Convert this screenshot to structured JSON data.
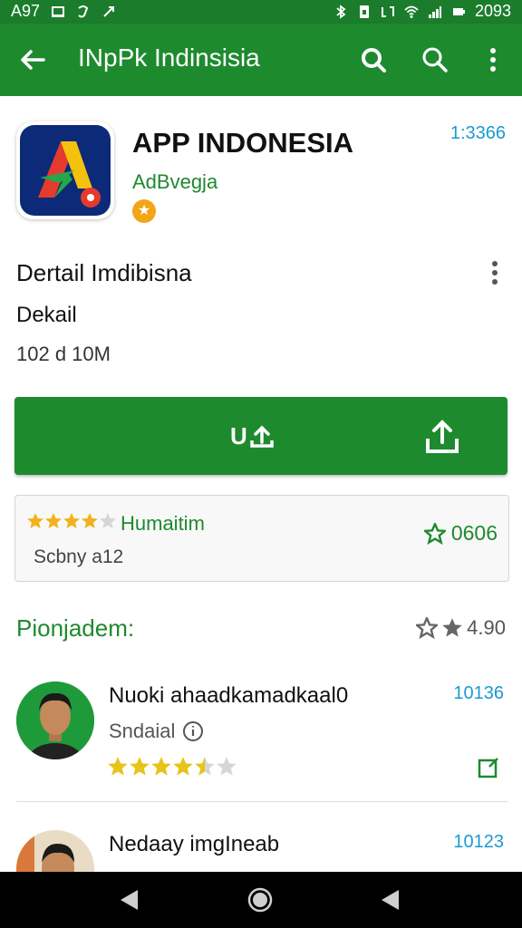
{
  "status_bar": {
    "left_text": "A97",
    "right_text": "2093"
  },
  "app_bar": {
    "title": "INpPk Indinsisia",
    "back_icon": "arrow-back-icon",
    "actions": [
      "search-icon",
      "search-icon",
      "more-vert-icon"
    ]
  },
  "app": {
    "name": "APP INDONESIA",
    "developer": "AdBvegja",
    "badge": "★",
    "time": "1:3366"
  },
  "detail": {
    "title": "Dertail Imdibisna",
    "subtitle": "Dekail",
    "size": "102 d 10M"
  },
  "install": {
    "label": "U"
  },
  "rating_card": {
    "label": "Humaitim",
    "sub": "Scbny a12",
    "value": "0606",
    "stars_full": 4,
    "stars_total": 5
  },
  "section": {
    "title": "Pionjadem:",
    "rating": "4.90"
  },
  "reviews": [
    {
      "name": "Nuoki ahaadkamadkaal0",
      "time": "10136",
      "role": "Sndaial",
      "rating": 4.5
    },
    {
      "name": "Nedaay imgIneab",
      "time": "10123",
      "role": "",
      "rating": 0
    }
  ],
  "colors": {
    "primary": "#1e8a2e",
    "status_bar": "#1b7d2c",
    "accent_blue": "#1a9bd0",
    "star": "#f2b21b"
  }
}
